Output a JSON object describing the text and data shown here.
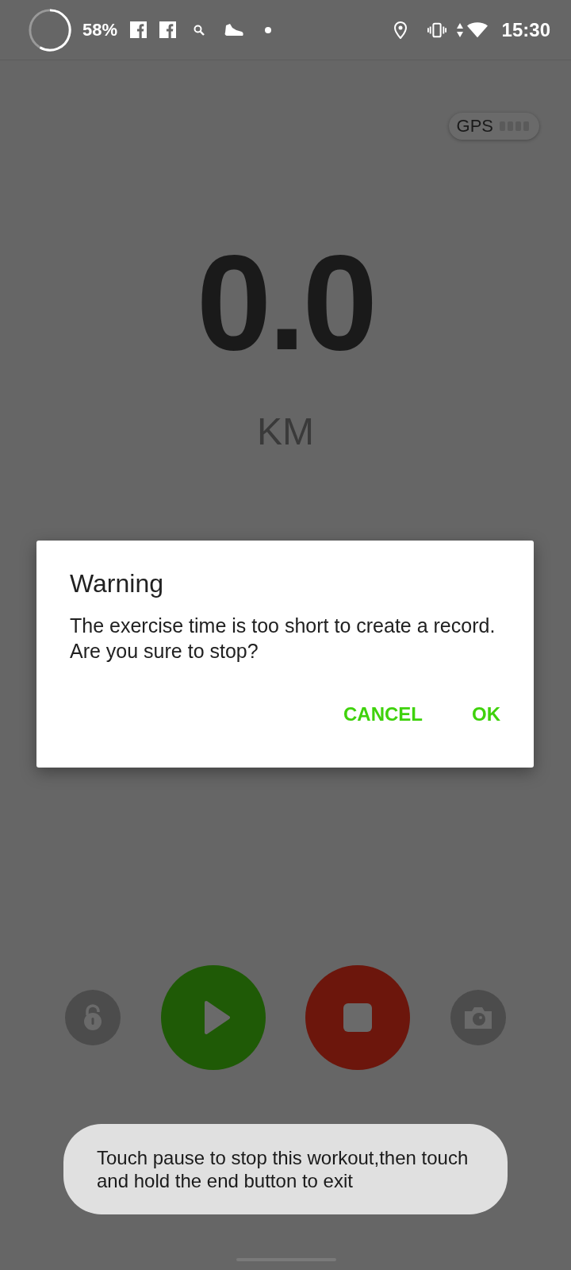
{
  "status_bar": {
    "battery": "58%",
    "time": "15:30"
  },
  "gps": {
    "label": "GPS"
  },
  "distance": {
    "value": "0.0",
    "unit": "KM"
  },
  "dialog": {
    "title": "Warning",
    "message": "The exercise time is too short to create a record. Are you sure to stop?",
    "buttons": [
      "CANCEL",
      "OK"
    ]
  },
  "toast": {
    "text": "Touch pause to stop this workout,then touch and hold the end button to exit"
  }
}
